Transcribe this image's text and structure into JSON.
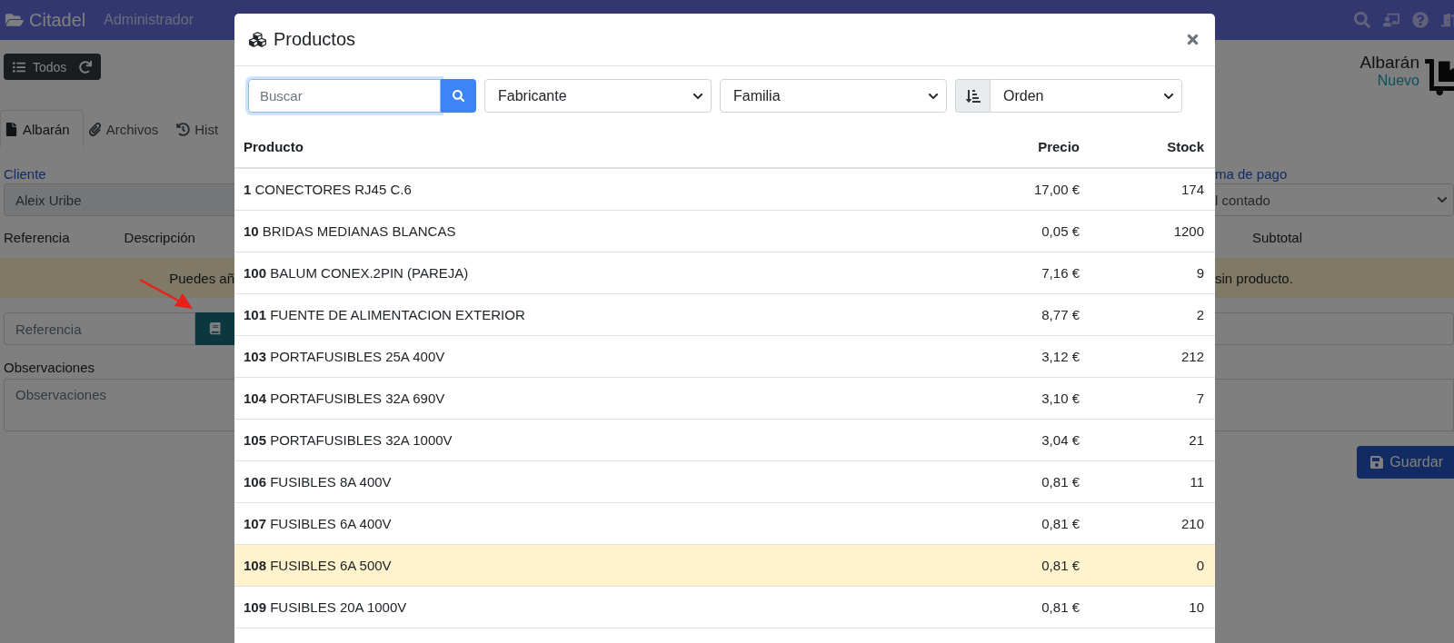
{
  "navbar": {
    "brand": "Citadel",
    "menu": [
      "Administrador"
    ]
  },
  "toolbar": {
    "all_button": "Todos",
    "document_title": "Albarán",
    "document_status": "Nuevo"
  },
  "tabs": [
    {
      "label": "Albarán",
      "selected": true
    },
    {
      "label": "Archivos",
      "selected": false
    },
    {
      "label": "Hist",
      "selected": false
    }
  ],
  "form": {
    "client_label": "Cliente",
    "client_value": "Aleix Uribe",
    "payment_label": "ma de pago",
    "payment_value": "l contado"
  },
  "lines": {
    "columns": [
      "Referencia",
      "Descripción",
      "Subtotal"
    ],
    "notice_start": "Puedes añ",
    "notice_end": "sin producto.",
    "reference_placeholder": "Referencia"
  },
  "observations": {
    "label": "Observaciones",
    "placeholder": "Observaciones"
  },
  "save_button": "Guardar",
  "modal": {
    "title": "Productos",
    "search_placeholder": "Buscar",
    "filters": [
      "Fabricante",
      "Familia"
    ],
    "sort": "Orden",
    "columns": [
      "Producto",
      "Precio",
      "Stock"
    ],
    "rows": [
      {
        "code": "1",
        "name": "CONECTORES RJ45 C.6",
        "price": "17,00 €",
        "stock": "174",
        "highlighted": false
      },
      {
        "code": "10",
        "name": "BRIDAS MEDIANAS BLANCAS",
        "price": "0,05 €",
        "stock": "1200",
        "highlighted": false
      },
      {
        "code": "100",
        "name": "BALUM CONEX.2PIN (PAREJA)",
        "price": "7,16 €",
        "stock": "9",
        "highlighted": false
      },
      {
        "code": "101",
        "name": "FUENTE DE ALIMENTACION EXTERIOR",
        "price": "8,77 €",
        "stock": "2",
        "highlighted": false
      },
      {
        "code": "103",
        "name": "PORTAFUSIBLES 25A 400V",
        "price": "3,12 €",
        "stock": "212",
        "highlighted": false
      },
      {
        "code": "104",
        "name": "PORTAFUSIBLES 32A 690V",
        "price": "3,10 €",
        "stock": "7",
        "highlighted": false
      },
      {
        "code": "105",
        "name": "PORTAFUSIBLES 32A 1000V",
        "price": "3,04 €",
        "stock": "21",
        "highlighted": false
      },
      {
        "code": "106",
        "name": "FUSIBLES 8A 400V",
        "price": "0,81 €",
        "stock": "11",
        "highlighted": false
      },
      {
        "code": "107",
        "name": "FUSIBLES 6A 400V",
        "price": "0,81 €",
        "stock": "210",
        "highlighted": false
      },
      {
        "code": "108",
        "name": "FUSIBLES 6A 500V",
        "price": "0,81 €",
        "stock": "0",
        "highlighted": true
      },
      {
        "code": "109",
        "name": "FUSIBLES 20A 1000V",
        "price": "0,81 €",
        "stock": "10",
        "highlighted": false
      }
    ]
  }
}
